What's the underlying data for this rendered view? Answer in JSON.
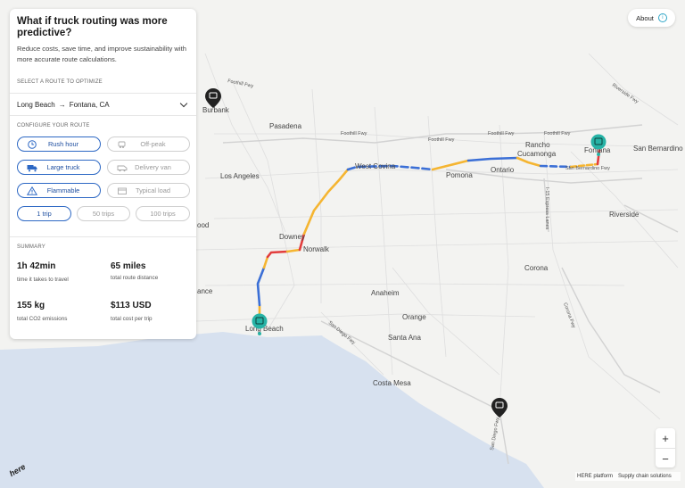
{
  "panel": {
    "title": "What if truck routing was more predictive?",
    "description": "Reduce costs, save time, and improve sustainability with more accurate route calculations.",
    "select_route_heading": "SELECT A ROUTE TO OPTIMIZE",
    "route": {
      "from": "Long Beach",
      "arrow": "→",
      "to": "Fontana, CA"
    },
    "configure_heading": "CONFIGURE YOUR ROUTE",
    "options": [
      {
        "label": "Rush hour",
        "icon": "clock-icon",
        "selected": true
      },
      {
        "label": "Off-peak",
        "icon": "traffic-icon",
        "selected": false
      },
      {
        "label": "Large truck",
        "icon": "truck-icon",
        "selected": true
      },
      {
        "label": "Delivery van",
        "icon": "van-icon",
        "selected": false
      },
      {
        "label": "Flammable",
        "icon": "warning-icon",
        "selected": true
      },
      {
        "label": "Typical load",
        "icon": "box-icon",
        "selected": false
      }
    ],
    "trips": [
      {
        "label": "1 trip",
        "selected": true
      },
      {
        "label": "50 trips",
        "selected": false
      },
      {
        "label": "100 trips",
        "selected": false
      }
    ],
    "summary_heading": "SUMMARY",
    "summary": [
      {
        "value": "1h 42min",
        "label": "time it takes to travel"
      },
      {
        "value": "65 miles",
        "label": "total route distance"
      },
      {
        "value": "155 kg",
        "label": "total CO2 emissions"
      },
      {
        "value": "$113 USD",
        "label": "total cost per trip"
      }
    ]
  },
  "about": {
    "label": "About",
    "icon": "info-icon",
    "info_glyph": "i"
  },
  "zoom": {
    "in": "+",
    "out": "−"
  },
  "attribution": {
    "platform": "HERE platform",
    "solutions": "Supply chain solutions"
  },
  "logo": "here",
  "map": {
    "cities": {
      "burbank": "Burbank",
      "pasadena": "Pasadena",
      "los_angeles": "Los Angeles",
      "west_covina": "West Covina",
      "pomona": "Pomona",
      "ontario": "Ontario",
      "rancho": "Rancho",
      "cucamonga": "Cucamonga",
      "fontana": "Fontana",
      "san_bernardino": "San Bernardino",
      "riverside": "Riverside",
      "downey": "Downey",
      "norwalk": "Norwalk",
      "corona": "Corona",
      "anaheim": "Anaheim",
      "orange": "Orange",
      "santa_ana": "Santa Ana",
      "costa_mesa": "Costa Mesa",
      "long_beach": "Long Beach",
      "ood": "ood",
      "ance": "ance"
    },
    "roads": {
      "foothill_1": "Foothill Fwy",
      "foothill_2": "Foothill Fwy",
      "foothill_3": "Foothill Fwy",
      "foothill_4": "Foothill Fwy",
      "foothill_5": "Foothill Fwy",
      "riverside_fwy": "Riverside Fwy",
      "i15": "I-15 Express Lanes",
      "corona_fwy": "Corona Fwy",
      "sd_fwy_1": "San Diego Fwy",
      "sd_fwy_2": "San Diego Fwy",
      "san_bernardino_fwy": "San Bernardino Fwy"
    },
    "colors": {
      "fast": "#3b6fd6",
      "moderate": "#f5b531",
      "slow": "#e23d3d",
      "pin_origin": "#27b3a6",
      "pin_other": "#222222"
    }
  }
}
